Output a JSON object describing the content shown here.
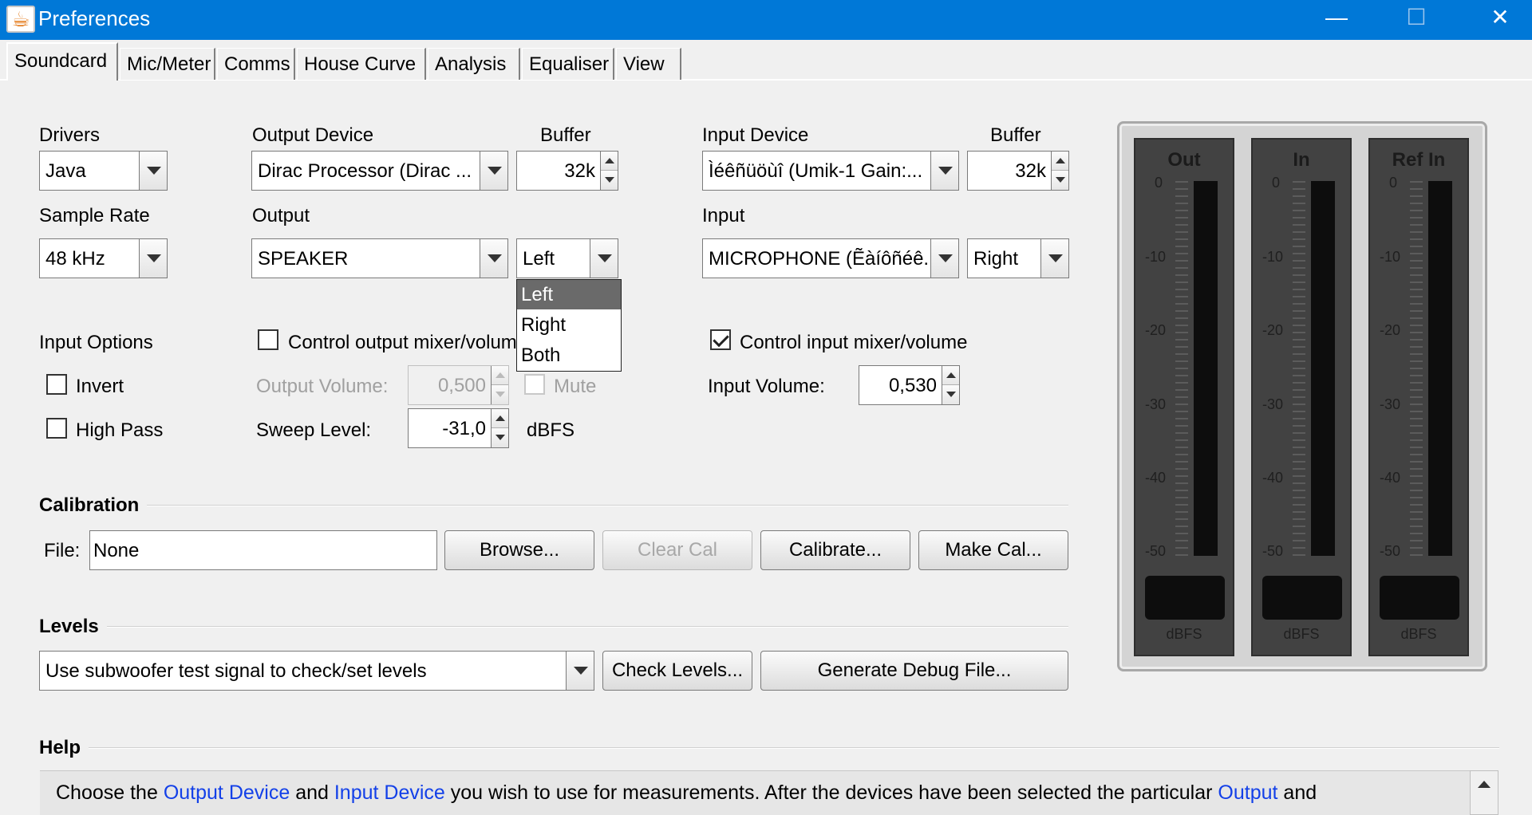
{
  "window": {
    "title": "Preferences",
    "icon": "java-icon",
    "minimize": "—",
    "maximize": "☐",
    "close": "✕"
  },
  "tabs": [
    "Soundcard",
    "Mic/Meter",
    "Comms",
    "House Curve",
    "Analysis",
    "Equaliser",
    "View"
  ],
  "soundcard": {
    "drivers_label": "Drivers",
    "drivers_value": "Java",
    "output_device_label": "Output Device",
    "output_device_value": "Dirac Processor (Dirac ...",
    "output_buffer_label": "Buffer",
    "output_buffer_value": "32k",
    "input_device_label": "Input Device",
    "input_device_value": "Ìéêñüöùî (Umik-1  Gain:...",
    "input_buffer_label": "Buffer",
    "input_buffer_value": "32k",
    "sample_rate_label": "Sample Rate",
    "sample_rate_value": "48 kHz",
    "output_label": "Output",
    "output_value": "SPEAKER",
    "output_channel_value": "Left",
    "input_label": "Input",
    "input_value": "MICROPHONE (Ẽàíôñéê...",
    "input_channel_value": "Right",
    "channel_options": [
      "Left",
      "Right",
      "Both"
    ],
    "channel_selected": "Left"
  },
  "options": {
    "input_options_label": "Input Options",
    "invert_label": "Invert",
    "invert_checked": false,
    "high_pass_label": "High Pass",
    "high_pass_checked": false,
    "control_output_label": "Control output mixer/volume",
    "control_output_checked": false,
    "output_volume_label": "Output Volume:",
    "output_volume_value": "0,500",
    "mute_label": "Mute",
    "sweep_level_label": "Sweep Level:",
    "sweep_level_value": "-31,0",
    "sweep_level_unit": "dBFS",
    "control_input_label": "Control input mixer/volume",
    "control_input_checked": true,
    "input_volume_label": "Input Volume:",
    "input_volume_value": "0,530"
  },
  "calibration": {
    "heading": "Calibration",
    "file_label": "File:",
    "file_value": "None",
    "browse": "Browse...",
    "clear_cal": "Clear Cal",
    "calibrate": "Calibrate...",
    "make_cal": "Make Cal..."
  },
  "levels": {
    "heading": "Levels",
    "mode_value": "Use subwoofer test signal to check/set levels",
    "check_levels": "Check Levels...",
    "generate_debug": "Generate Debug File..."
  },
  "meters": [
    {
      "title": "Out",
      "unit": "dBFS",
      "ticks": [
        "0",
        "-10",
        "-20",
        "-30",
        "-40",
        "-50"
      ],
      "level": 0
    },
    {
      "title": "In",
      "unit": "dBFS",
      "ticks": [
        "0",
        "-10",
        "-20",
        "-30",
        "-40",
        "-50"
      ],
      "level": 0
    },
    {
      "title": "Ref In",
      "unit": "dBFS",
      "ticks": [
        "0",
        "-10",
        "-20",
        "-30",
        "-40",
        "-50"
      ],
      "level": 0
    }
  ],
  "help": {
    "heading": "Help",
    "t1": "Choose the ",
    "h1": "Output Device",
    "t2": " and ",
    "h2": "Input Device",
    "t3": " you wish to use for measurements. After the devices have been selected the particular ",
    "h3": "Output",
    "t4": " and",
    "link_color": "#1340e8"
  },
  "colors": {
    "titlebar": "#0078d7",
    "window_bg": "#f0f0f0",
    "dropdown_selection": "#6a6a6a"
  }
}
